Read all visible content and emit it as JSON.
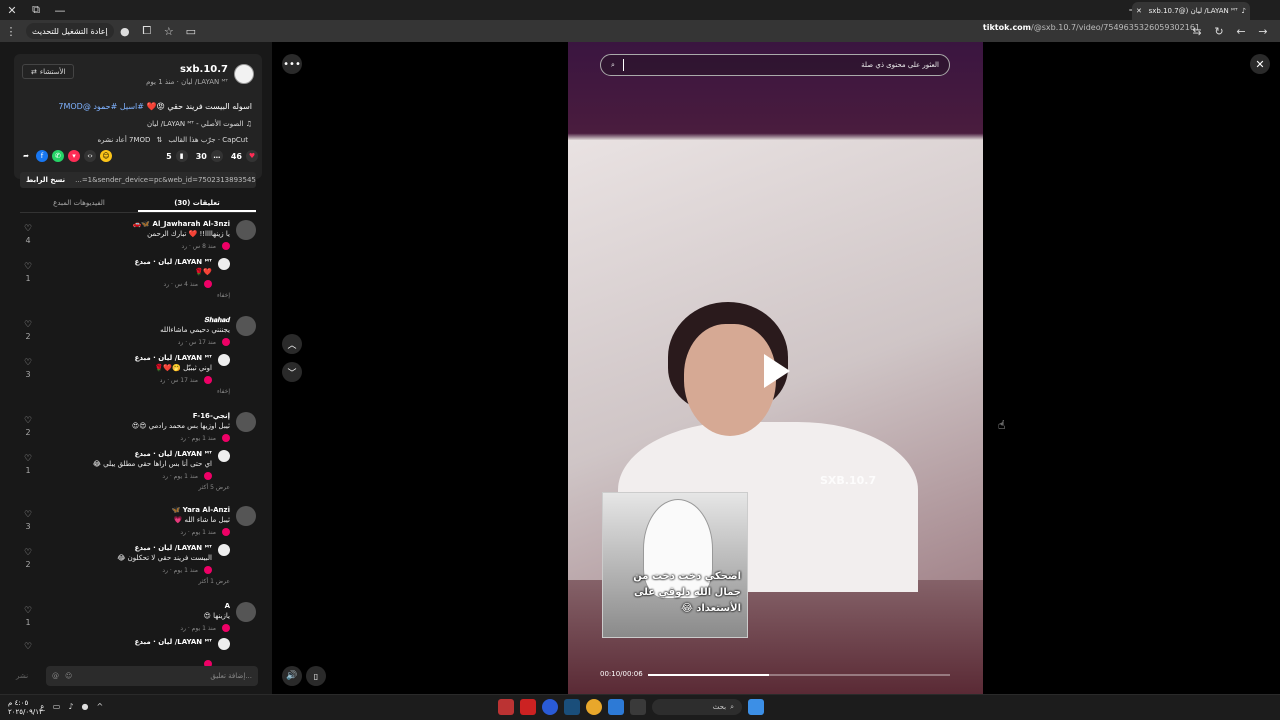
{
  "browser": {
    "tab_title": "LAYAN ᴹᵀ/ ليان (@sxb.10.7",
    "update_button": "إعادة التشغيل للتحديث",
    "url_domain": "tiktok.com",
    "url_path": "/@sxb.10.7/video/7549635326059302161"
  },
  "video_info": {
    "username": "sxb.10.7",
    "display_line": "LAYAN ᴹᵀ/ ليان · منذ 1 يوم",
    "follow_label": "الأستشاء",
    "caption_text": "اسوله البيست فريند حقي 😡❤️",
    "caption_tags": "#اسيل #حمود @7MOD",
    "sound": "الصوت الأصلي - LAYAN ᴹᵀ/ ليان",
    "capcut_label": "CapCut · جرّب هذا القالب",
    "repost_label": "7MOD أعاد نشره"
  },
  "stats": {
    "likes": "46",
    "comments": "30",
    "saves": "5"
  },
  "link": {
    "value": "...=1&sender_device=pc&web_id=7502313893545920007",
    "copy_label": "نسخ الرابط"
  },
  "tabs": {
    "comments": "تعليقات (30)",
    "creator_videos": "الفيديوهات المبدع"
  },
  "comments": [
    {
      "name": "Al_Jawharah Al-3nzi 🦋🚗",
      "text": "يا زينهاااا!! ❤️ تبارك الرحمن",
      "meta": "منذ 8 س · رد",
      "likes": "4"
    },
    {
      "name": "LAYAN ᴹᵀ/ ليان · مبدع",
      "text": "❤️🌹",
      "meta": "منذ 4 س · رد",
      "likes": "1",
      "hide": "إخفاء"
    },
    {
      "name": "𝑺𝒉𝒂𝒉𝒂𝒅",
      "text": "يجننني دحيمي ماشاءالله",
      "meta": "منذ 17 س · رد",
      "likes": "2"
    },
    {
      "name": "LAYAN ᴹᵀ/ ليان · مبدع",
      "text": "اوني ثيبيّل 🤭❤️🌹",
      "meta": "منذ 17 س · رد",
      "likes": "3",
      "hide": "إخفاء"
    },
    {
      "name": "إنجي-F-16",
      "text": "ثيبل اوزيها بس محمد رادمي 😍😍",
      "meta": "منذ 1 يوم · رد",
      "likes": "2"
    },
    {
      "name": "LAYAN ᴹᵀ/ ليان · مبدع",
      "text": "اي حتى أنا بس اراها حقي مطلق يبلي 😂",
      "meta": "منذ 1 يوم · رد",
      "likes": "1",
      "hide": "عرض 5 أكثر"
    },
    {
      "name": "Yara Al-Anzi 🦋",
      "text": "ثيبل ما شاء الله 💗",
      "meta": "منذ 1 يوم · رد",
      "likes": "3"
    },
    {
      "name": "LAYAN ᴹᵀ/ ليان · مبدع",
      "text": "البيست فريند حقي لا تحكلون 😂",
      "meta": "منذ 1 يوم · رد",
      "likes": "2",
      "hide": "عرض 1 أكثر"
    },
    {
      "name": "A",
      "text": "يازينها 😍",
      "meta": "منذ 1 يوم · رد",
      "likes": "1"
    },
    {
      "name": "LAYAN ᴹᵀ/ ليان · مبدع",
      "text": "",
      "meta": "",
      "likes": ""
    }
  ],
  "comment_input": {
    "placeholder": "إضافة تعليق...",
    "post_label": "نشر"
  },
  "player": {
    "search_placeholder": "العثور على محتوى ذي صلة",
    "watermark": "SXB.10.7",
    "sticker_text": "اضحكي دخت دخت من جمال الله دلوقي على الأستعداد 😂",
    "time": "00:10/00:06",
    "progress": 0.4
  },
  "taskbar": {
    "time": "٤:٠٥ م",
    "date": "٢٠٢٥/٠٩/١٣",
    "search_label": "بحث"
  }
}
